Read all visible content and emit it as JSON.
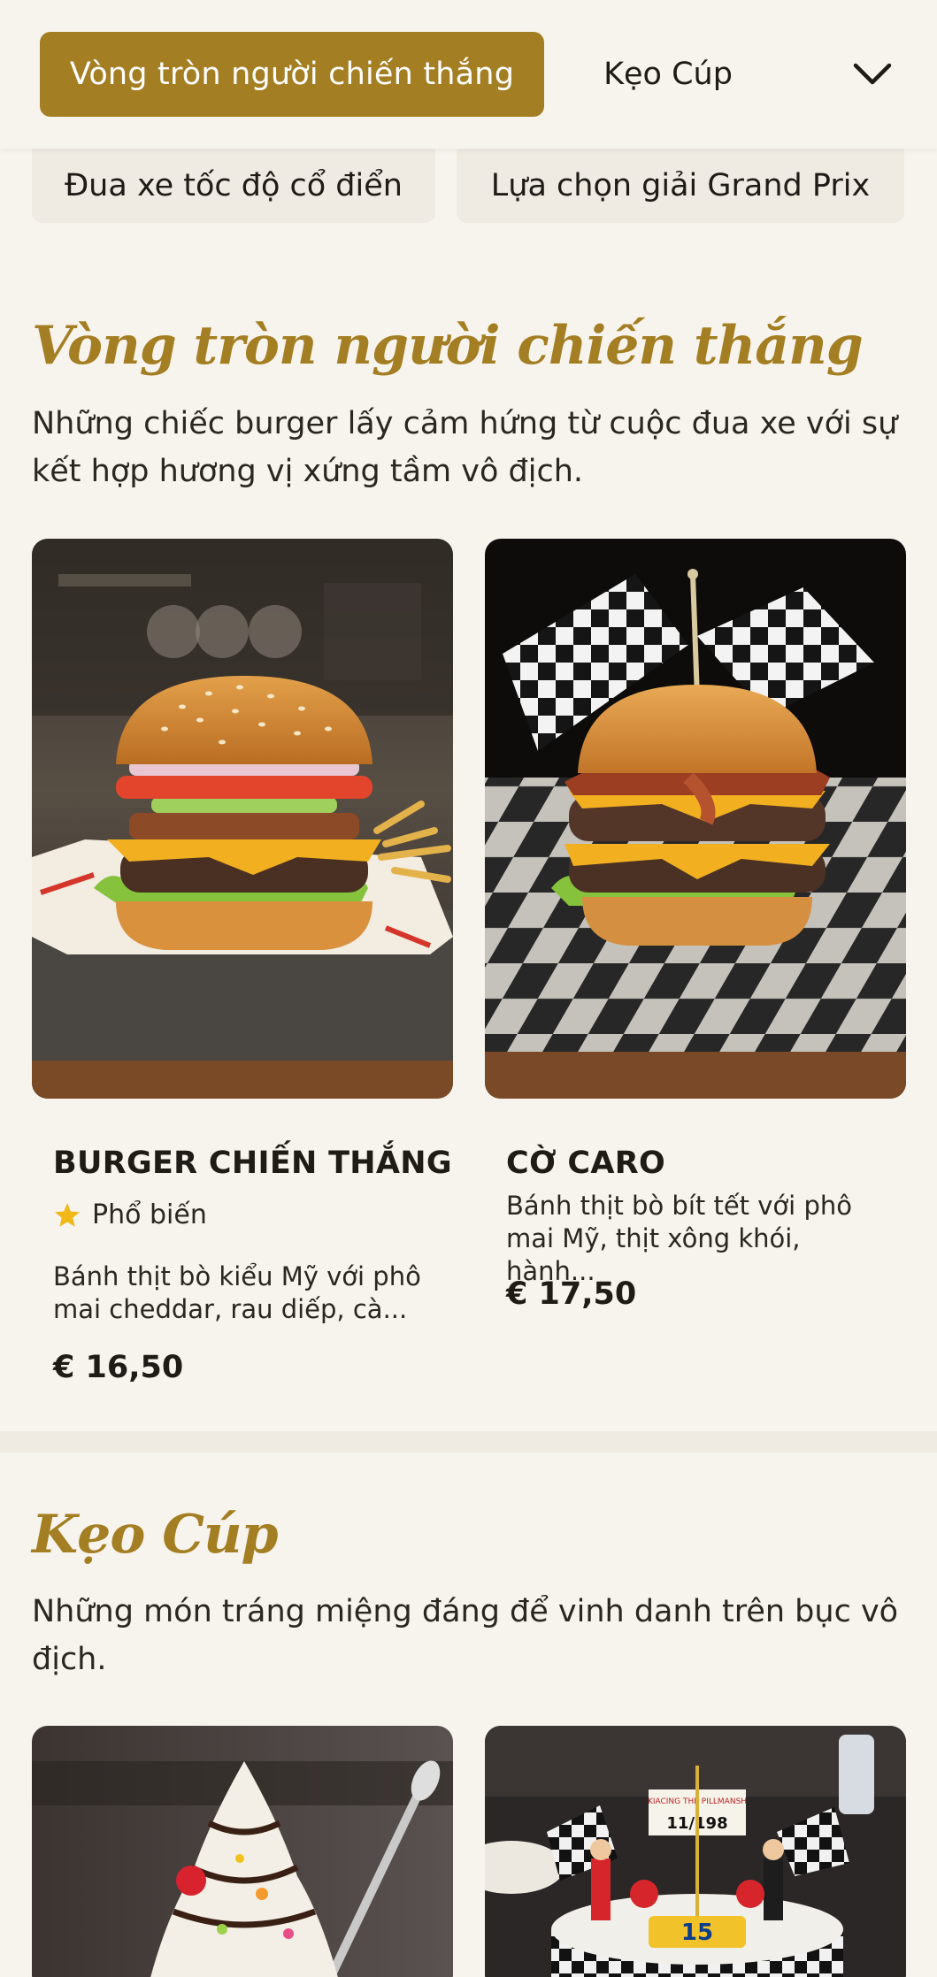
{
  "header": {
    "active_tab": "Vòng tròn người chiến thắng",
    "second_tab": "Kẹo Cúp",
    "subtabs": [
      "Đua xe tốc độ cổ điển",
      "Lựa chọn giải Grand Prix"
    ]
  },
  "section1": {
    "title": "Vòng tròn người chiến thắng",
    "description": "Những chiếc burger lấy cảm hứng từ cuộc đua xe với sự kết hợp hương vị xứng tầm vô địch.",
    "items": [
      {
        "name": "BURGER CHIẾN THẮNG",
        "badge": "Phổ biến",
        "description_line1": "Bánh thịt bò kiểu Mỹ với phô",
        "description_line2": "mai cheddar, rau diếp, cà...",
        "price": "€ 16,50"
      },
      {
        "name": "CỜ CARO",
        "description_line1": "Bánh thịt bò bít tết với phô",
        "description_line2": "mai Mỹ, thịt xông khói, hành...",
        "price": "€ 17,50"
      }
    ]
  },
  "section2": {
    "title": "Kẹo Cúp",
    "description": "Những món tráng miệng đáng để vinh danh trên bục vô địch."
  },
  "colors": {
    "accent": "#a47e22",
    "background": "#f7f4ee",
    "pill_bg": "#efebe2",
    "star": "#f0b818"
  },
  "icons": [
    "chevron-down-icon",
    "star-icon"
  ]
}
